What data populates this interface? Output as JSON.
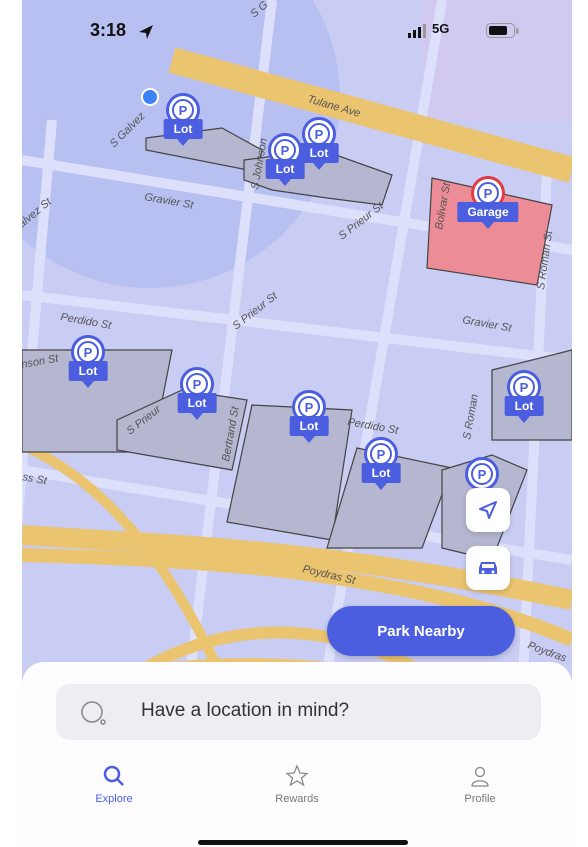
{
  "status_bar": {
    "time": "3:18",
    "network": "5G"
  },
  "map": {
    "streets": [
      "Tulane Ave",
      "Gravier St",
      "Gravier St",
      "Perdido St",
      "Perdido St",
      "S Prieur St",
      "S Prieur St",
      "S Prieur",
      "Bertrand St",
      "Poydras St",
      "Poydras",
      "S Roman St",
      "S Roman",
      "Bolivar St",
      "S Galvez",
      "alvez St",
      "S Johnson",
      "nson St",
      "ss St",
      "S G"
    ],
    "pins": [
      {
        "label": "Lot"
      },
      {
        "label": "Lot"
      },
      {
        "label": "Lot"
      },
      {
        "label": "Garage"
      },
      {
        "label": "Lot"
      },
      {
        "label": "Lot"
      },
      {
        "label": "Lot"
      },
      {
        "label": "Lot"
      },
      {
        "label": "Lot"
      }
    ],
    "pin_letter": "P"
  },
  "actions": {
    "park_nearby": "Park Nearby"
  },
  "search": {
    "placeholder": "Have a location in mind?"
  },
  "tabs": [
    {
      "label": "Explore",
      "icon": "search-icon",
      "active": true
    },
    {
      "label": "Rewards",
      "icon": "star-icon",
      "active": false
    },
    {
      "label": "Profile",
      "icon": "person-icon",
      "active": false
    }
  ],
  "colors": {
    "accent": "#4b5ee0",
    "garage": "#e03a45",
    "map_bg": "#c9ccf3"
  }
}
